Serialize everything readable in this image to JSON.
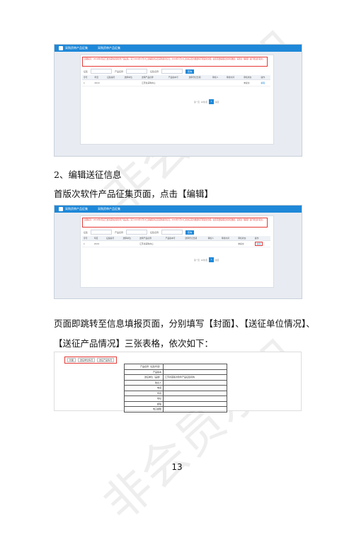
{
  "screenshot1": {
    "appbar": {
      "tab1": "采购资审产品征集",
      "tab2": "采购资审产品征集"
    },
    "notice": "温馨提示：2019年6月起已更新采购资审软件产品征集，请于2019年7月15日前编辑并完善采购资审信息；2019年7月15日前未完善的数据将不能提交审核，如您需要编辑提交审核数据，请通过【编辑】进行修改并提交。",
    "filters": {
      "label1": "征集",
      "label2": "产品名称",
      "label3": "征集名称",
      "query": "查询"
    },
    "table": {
      "headers": [
        "序号",
        "年度",
        "征集编号",
        "送审单位",
        "送审产品名称",
        "产品版本号",
        "送审登记日期",
        "审核人",
        "审核时间",
        "审核状态",
        "操作"
      ],
      "row": [
        "1",
        "2019",
        "",
        "",
        "江苏省采购中心",
        "",
        "",
        "",
        "",
        "未提交",
        "编辑"
      ]
    },
    "pager": {
      "first": "第一页",
      "per": "10条/页",
      "current": "1",
      "last": "尾页"
    }
  },
  "para1": "2、编辑送征信息",
  "para2": "首版次软件产品征集页面，点击【编辑】",
  "screenshot2": {
    "appbar": {
      "tab1": "采购资审产品征集",
      "tab2": "采购资审产品征集"
    },
    "notice": "温馨提示：2019年6月起已更新采购资审软件产品征集，请于2019年7月15日前编辑并完善采购资审信息；2019年7月15日前未完善的数据将不能提交审核，如您需要编辑提交审核数据，请通过【编辑】进行修改并提交。",
    "filters": {
      "label1": "征集",
      "label2": "产品名称",
      "label3": "征集名称",
      "query": "查询"
    },
    "table": {
      "headers": [
        "序号",
        "年度",
        "征集编号",
        "送审单位",
        "送审产品名称",
        "产品版本号",
        "送审登记日期",
        "审核人",
        "审核时间",
        "审核状态",
        "操作"
      ],
      "row": [
        "1",
        "2019",
        "",
        "",
        "江苏省采购中心",
        "",
        "",
        "",
        "",
        "未提交",
        "编辑"
      ]
    },
    "pager": {
      "first": "第一页",
      "per": "10条/页",
      "current": "1",
      "last": "尾页"
    }
  },
  "para3": "页面即跳转至信息填报页面，分别填写【封面】、【送征单位情况】、",
  "para4": "【送征产品情况】三张表格，依次如下：",
  "screenshot3": {
    "tabs": [
      "封面",
      "送征单位情况",
      "送征产品情况"
    ],
    "rows": [
      {
        "k": "产品名称（征集年度）",
        "v": ""
      },
      {
        "k": "产品版本",
        "v": ""
      },
      {
        "k": "送征单位（盖章）",
        "v": "江苏省首版次软件产品征集机构"
      },
      {
        "k": "联系人",
        "v": ""
      },
      {
        "k": "电话",
        "v": ""
      },
      {
        "k": "传真",
        "v": ""
      },
      {
        "k": "地址",
        "v": ""
      },
      {
        "k": "邮编",
        "v": ""
      },
      {
        "k": "电子邮箱",
        "v": ""
      }
    ]
  },
  "watermark": "非会员水印",
  "page_number": "13"
}
